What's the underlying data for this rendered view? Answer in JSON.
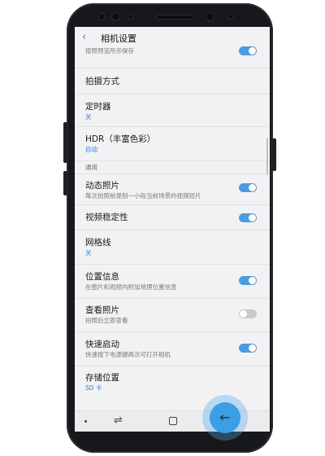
{
  "header": {
    "back_icon": "‹",
    "title": "相机设置"
  },
  "rows": [
    {
      "label": "",
      "sub": "按照预览所示保存",
      "toggle": true
    },
    {
      "label": "拍摄方式",
      "sub": ""
    },
    {
      "label": "定时器",
      "sub": "关"
    },
    {
      "label": "HDR（丰富色彩）",
      "sub": "自动"
    },
    {
      "section": "通用"
    },
    {
      "label": "动态照片",
      "sub": "每次拍照前录制一小段当前场景的视频短片",
      "toggle": true
    },
    {
      "label": "视频稳定性",
      "sub": "",
      "toggle": true
    },
    {
      "label": "网格线",
      "sub": "关"
    },
    {
      "label": "位置信息",
      "sub": "在图片和视频内附加地理位置信息",
      "toggle": true
    },
    {
      "label": "查看照片",
      "sub": "拍照后立即查看",
      "toggle": false
    },
    {
      "label": "快速启动",
      "sub": "快速按下电源键两次可打开相机",
      "toggle": true
    },
    {
      "label": "存储位置",
      "sub": "SD 卡"
    }
  ],
  "nav": {
    "recent_icon": "⇌",
    "back_icon": "←"
  },
  "colors": {
    "accent": "#3a7bd5",
    "toggle_on": "#4a9ce0",
    "toggle_off": "#c9c9cc",
    "highlight": "#3c9ee5"
  }
}
